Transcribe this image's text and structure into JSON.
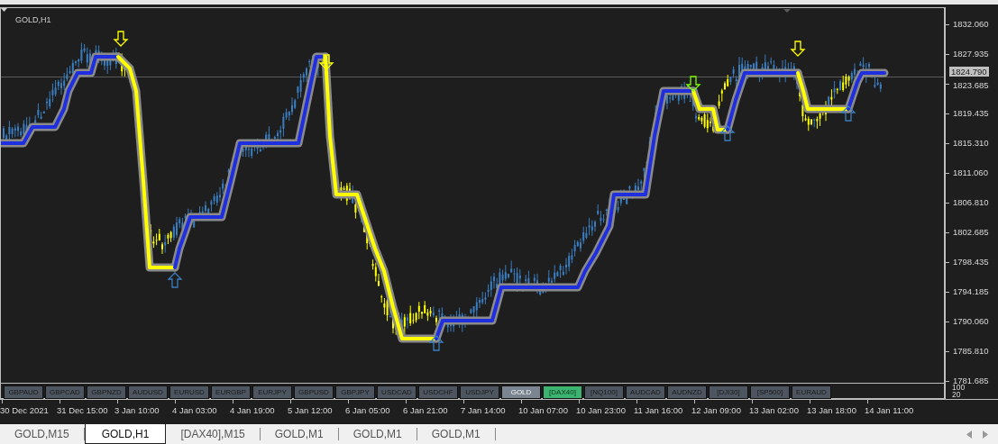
{
  "chart": {
    "title": "GOLD,H1",
    "current_price": "1824.790",
    "price_labels": [
      "1832.060",
      "1827.935",
      "1823.685",
      "1819.435",
      "1815.310",
      "1811.060",
      "1806.810",
      "1802.685",
      "1798.435",
      "1794.185",
      "1790.060",
      "1785.810",
      "1781.685"
    ],
    "indicator_labels": [
      "100",
      "20"
    ],
    "time_labels": [
      "30 Dec 2021",
      "31 Dec 15:00",
      "3 Jan 10:00",
      "4 Jan 03:00",
      "4 Jan 19:00",
      "5 Jan 12:00",
      "6 Jan 05:00",
      "6 Jan 21:00",
      "7 Jan 14:00",
      "10 Jan 07:00",
      "10 Jan 23:00",
      "11 Jan 16:00",
      "12 Jan 09:00",
      "13 Jan 02:00",
      "13 Jan 18:00",
      "14 Jan 11:00"
    ]
  },
  "symbol_buttons": [
    {
      "label": "GBPAUD",
      "kind": "normal"
    },
    {
      "label": "GBPCAD",
      "kind": "normal"
    },
    {
      "label": "GBPNZD",
      "kind": "normal"
    },
    {
      "label": "AUDUSD",
      "kind": "normal"
    },
    {
      "label": "EURUSD",
      "kind": "normal"
    },
    {
      "label": "EURGBP",
      "kind": "normal"
    },
    {
      "label": "EURJPY",
      "kind": "normal"
    },
    {
      "label": "GBPUSD",
      "kind": "normal"
    },
    {
      "label": "GBPJPY",
      "kind": "normal"
    },
    {
      "label": "USDCAD",
      "kind": "normal"
    },
    {
      "label": "USDCHF",
      "kind": "normal"
    },
    {
      "label": "USDJPY",
      "kind": "normal"
    },
    {
      "label": "GOLD",
      "kind": "current"
    },
    {
      "label": "[DAX40]",
      "kind": "marked"
    },
    {
      "label": "[NQ100]",
      "kind": "normal"
    },
    {
      "label": "AUDCAD",
      "kind": "normal"
    },
    {
      "label": "AUDNZD",
      "kind": "normal"
    },
    {
      "label": "[DJI30]",
      "kind": "normal"
    },
    {
      "label": "[SP500]",
      "kind": "normal"
    },
    {
      "label": "EURAUD",
      "kind": "normal"
    }
  ],
  "tabs": [
    {
      "label": "GOLD,M15",
      "selected": false
    },
    {
      "label": "GOLD,H1",
      "selected": true
    },
    {
      "label": "[DAX40],M15",
      "selected": false
    },
    {
      "label": "GOLD,M1",
      "selected": false
    },
    {
      "label": "GOLD,M1",
      "selected": false
    },
    {
      "label": "GOLD,M1",
      "selected": false
    }
  ]
}
